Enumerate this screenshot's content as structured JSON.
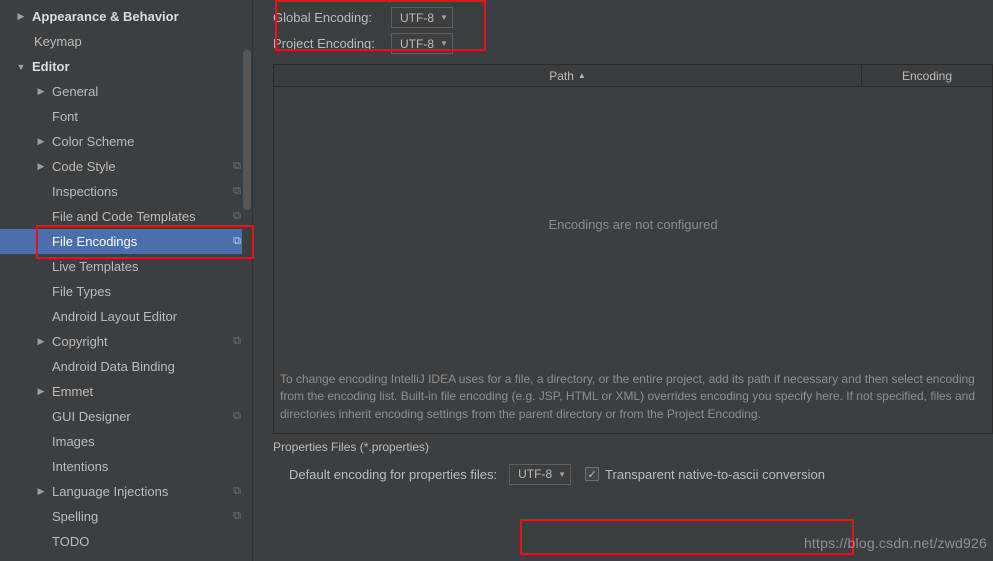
{
  "sidebar": {
    "items": [
      {
        "label": "Appearance & Behavior",
        "level": 0,
        "expandable": true,
        "expanded": false,
        "bold": true,
        "badge": false
      },
      {
        "label": "Keymap",
        "level": 0,
        "expandable": false,
        "bold": false,
        "badge": false,
        "noarrow": true
      },
      {
        "label": "Editor",
        "level": 0,
        "expandable": true,
        "expanded": true,
        "bold": true,
        "badge": false
      },
      {
        "label": "General",
        "level": 1,
        "expandable": true,
        "expanded": false,
        "bold": false,
        "badge": false
      },
      {
        "label": "Font",
        "level": 1,
        "expandable": false,
        "bold": false,
        "badge": false,
        "noarrow": true
      },
      {
        "label": "Color Scheme",
        "level": 1,
        "expandable": true,
        "expanded": false,
        "bold": false,
        "badge": false
      },
      {
        "label": "Code Style",
        "level": 1,
        "expandable": true,
        "expanded": false,
        "bold": false,
        "badge": true
      },
      {
        "label": "Inspections",
        "level": 1,
        "expandable": false,
        "bold": false,
        "badge": true,
        "noarrow": true
      },
      {
        "label": "File and Code Templates",
        "level": 1,
        "expandable": false,
        "bold": false,
        "badge": true,
        "noarrow": true
      },
      {
        "label": "File Encodings",
        "level": 1,
        "expandable": false,
        "bold": false,
        "badge": true,
        "noarrow": true,
        "selected": true
      },
      {
        "label": "Live Templates",
        "level": 1,
        "expandable": false,
        "bold": false,
        "badge": false,
        "noarrow": true
      },
      {
        "label": "File Types",
        "level": 1,
        "expandable": false,
        "bold": false,
        "badge": false,
        "noarrow": true
      },
      {
        "label": "Android Layout Editor",
        "level": 1,
        "expandable": false,
        "bold": false,
        "badge": false,
        "noarrow": true
      },
      {
        "label": "Copyright",
        "level": 1,
        "expandable": true,
        "expanded": false,
        "bold": false,
        "badge": true
      },
      {
        "label": "Android Data Binding",
        "level": 1,
        "expandable": false,
        "bold": false,
        "badge": false,
        "noarrow": true
      },
      {
        "label": "Emmet",
        "level": 1,
        "expandable": true,
        "expanded": false,
        "bold": false,
        "badge": false
      },
      {
        "label": "GUI Designer",
        "level": 1,
        "expandable": false,
        "bold": false,
        "badge": true,
        "noarrow": true
      },
      {
        "label": "Images",
        "level": 1,
        "expandable": false,
        "bold": false,
        "badge": false,
        "noarrow": true
      },
      {
        "label": "Intentions",
        "level": 1,
        "expandable": false,
        "bold": false,
        "badge": false,
        "noarrow": true
      },
      {
        "label": "Language Injections",
        "level": 1,
        "expandable": true,
        "expanded": false,
        "bold": false,
        "badge": true
      },
      {
        "label": "Spelling",
        "level": 1,
        "expandable": false,
        "bold": false,
        "badge": true,
        "noarrow": true
      },
      {
        "label": "TODO",
        "level": 1,
        "expandable": false,
        "bold": false,
        "badge": false,
        "noarrow": true
      }
    ]
  },
  "form": {
    "global_label": "Global Encoding:",
    "global_value": "UTF-8",
    "project_label": "Project Encoding:",
    "project_value": "UTF-8"
  },
  "table": {
    "col_path": "Path",
    "col_encoding": "Encoding",
    "empty_text": "Encodings are not configured"
  },
  "help": "To change encoding IntelliJ IDEA uses for a file, a directory, or the entire project, add its path if necessary and then select encoding from the encoding list. Built-in file encoding (e.g. JSP, HTML or XML) overrides encoding you specify here. If not specified, files and directories inherit encoding settings from the parent directory or from the Project Encoding.",
  "props": {
    "section": "Properties Files (*.properties)",
    "label": "Default encoding for properties files:",
    "value": "UTF-8",
    "checkbox_checked": true,
    "checkbox_label": "Transparent native-to-ascii conversion"
  },
  "watermark": "https://blog.csdn.net/zwd926"
}
